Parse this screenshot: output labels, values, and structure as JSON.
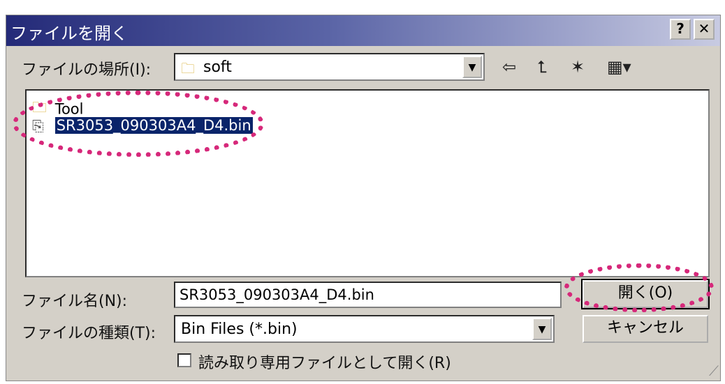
{
  "window": {
    "title": "ファイルを開く",
    "help_label": "?",
    "close_label": "✕"
  },
  "location": {
    "label": "ファイルの場所(I):",
    "value": "soft"
  },
  "toolbar": {
    "back": "⇦",
    "up": "⮤",
    "new_folder": "✶",
    "view": "▦▾"
  },
  "files": [
    {
      "name": "Tool",
      "type": "folder",
      "selected": false
    },
    {
      "name": "SR3053_090303A4_D4.bin",
      "type": "file",
      "selected": true
    }
  ],
  "filename": {
    "label": "ファイル名(N):",
    "value": "SR3053_090303A4_D4.bin"
  },
  "filetype": {
    "label": "ファイルの種類(T):",
    "value": "Bin Files (*.bin)"
  },
  "buttons": {
    "open": "開く(O)",
    "cancel": "キャンセル"
  },
  "readonly": {
    "label": "読み取り専用ファイルとして開く(R)",
    "checked": false
  },
  "colors": {
    "highlight": "#d6287a",
    "selection": "#0a246a"
  }
}
